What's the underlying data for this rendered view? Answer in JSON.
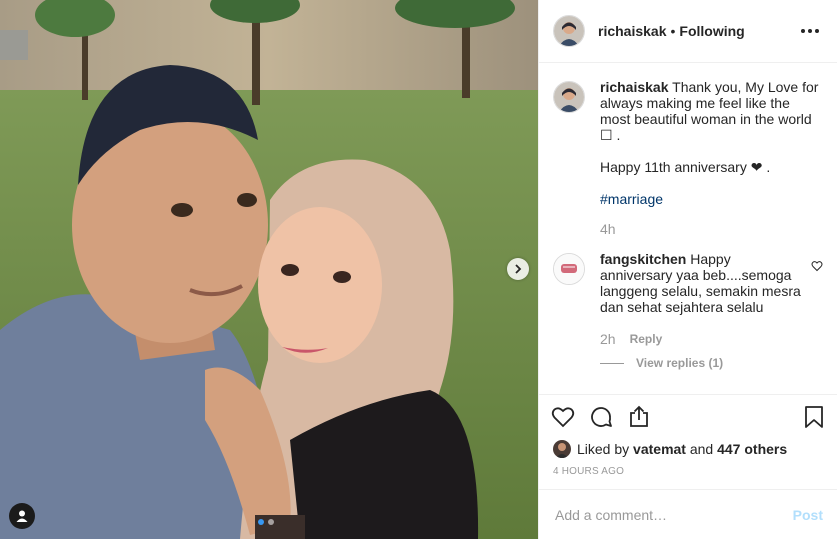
{
  "post": {
    "username": "richaiskak",
    "separator": "•",
    "follow_status": "Following",
    "more_icon": "more-options-icon"
  },
  "caption": {
    "username": "richaiskak",
    "text": "Thank you, My Love for always making me feel like the most beautiful woman in the world ☐ .\n\nHappy 11th anniversary ❤ .",
    "hashtag": "#marriage",
    "time": "4h"
  },
  "comment": {
    "username": "fangskitchen",
    "text": "Happy anniversary yaa beb....semoga langgeng selalu, semakin mesra dan sehat sejahtera selalu",
    "time": "2h",
    "reply_label": "Reply",
    "view_replies": "View replies (1)"
  },
  "actions": {
    "like_icon": "heart-icon",
    "comment_icon": "comment-icon",
    "share_icon": "share-icon",
    "save_icon": "bookmark-icon"
  },
  "likes": {
    "prefix": "Liked by",
    "user": "vatemat",
    "middle": "and",
    "others": "447 others"
  },
  "timestamp": "4 HOURS AGO",
  "add_comment": {
    "placeholder": "Add a comment…",
    "post_label": "Post"
  },
  "colors": {
    "link": "#003569",
    "muted": "#999999",
    "post_button": "#b2dffc",
    "carousel_active": "#3897f0"
  }
}
